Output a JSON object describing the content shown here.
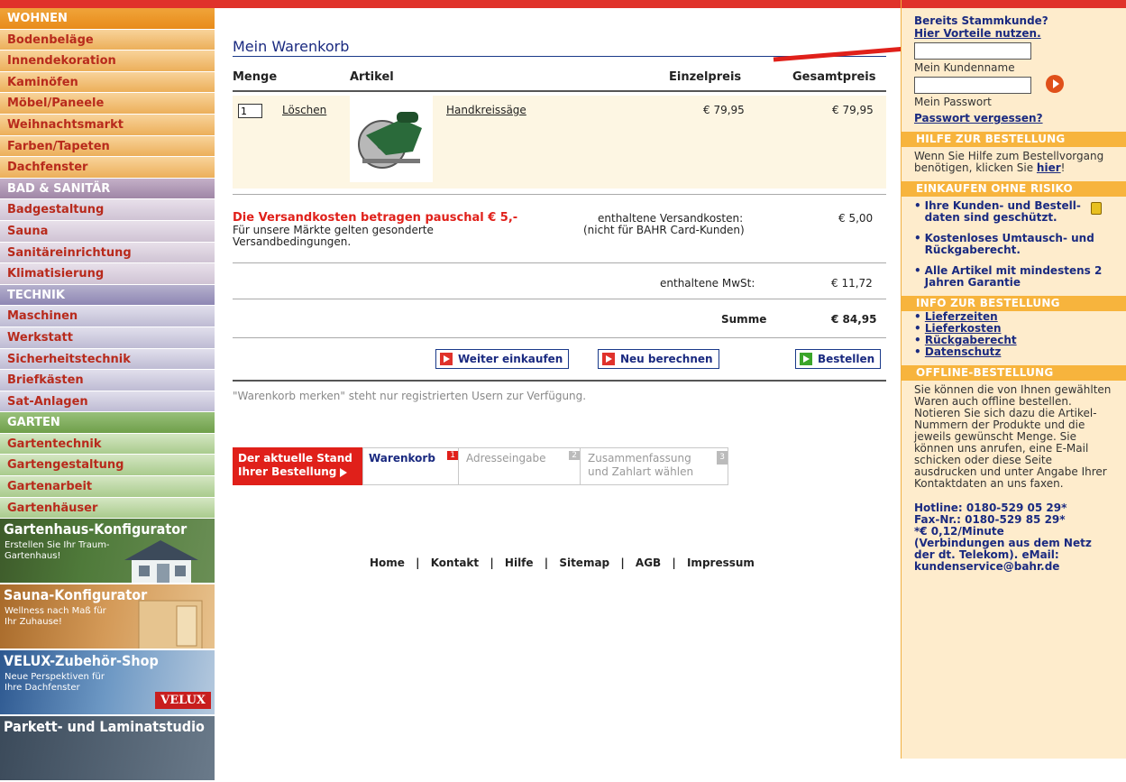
{
  "nav": {
    "items": [
      {
        "label": "WOHNEN"
      },
      {
        "label": "Bodenbeläge"
      },
      {
        "label": "Innendekoration"
      },
      {
        "label": "Kaminöfen"
      },
      {
        "label": "Möbel/Paneele"
      },
      {
        "label": "Weihnachtsmarkt"
      },
      {
        "label": "Farben/Tapeten"
      },
      {
        "label": "Dachfenster"
      },
      {
        "label": "BAD & SANITÄR"
      },
      {
        "label": "Badgestaltung"
      },
      {
        "label": "Sauna"
      },
      {
        "label": "Sanitäreinrichtung"
      },
      {
        "label": "Klimatisierung"
      },
      {
        "label": "TECHNIK"
      },
      {
        "label": "Maschinen"
      },
      {
        "label": "Werkstatt"
      },
      {
        "label": "Sicherheitstechnik"
      },
      {
        "label": "Briefkästen"
      },
      {
        "label": "Sat-Anlagen"
      },
      {
        "label": "GARTEN"
      },
      {
        "label": "Gartentechnik"
      },
      {
        "label": "Gartengestaltung"
      },
      {
        "label": "Gartenarbeit"
      },
      {
        "label": "Gartenhäuser"
      }
    ],
    "banners": [
      {
        "title": "Gartenhaus-Konfigurator",
        "sub": "Erstellen Sie Ihr Traum-Gartenhaus!"
      },
      {
        "title": "Sauna-Konfigurator",
        "sub": "Wellness nach Maß für Ihr Zuhause!"
      },
      {
        "title": "VELUX-Zubehör-Shop",
        "sub": "Neue Perspektiven für Ihre Dachfenster",
        "logo": "VELUX"
      },
      {
        "title": "Parkett- und Laminatstudio",
        "sub": ""
      }
    ]
  },
  "cart": {
    "title": "Mein Warenkorb",
    "headers": {
      "qty": "Menge",
      "article": "Artikel",
      "unit": "Einzelpreis",
      "total": "Gesamtpreis"
    },
    "item": {
      "qty": "1",
      "delete": "Löschen",
      "name": "Handkreissäge",
      "unit_price": "€ 79,95",
      "total_price": "€ 79,95",
      "image_icon": "circular-saw-image"
    },
    "shipping_notice": "Die Versandkosten betragen pauschal € 5,-",
    "shipping_sub": "Für unsere Märkte gelten gesonderte Versandbedingungen.",
    "shipping_label_1": "enthaltene Versandkosten:",
    "shipping_label_2": "(nicht für BAHR Card-Kunden)",
    "shipping_value": "€ 5,00",
    "vat_label": "enthaltene MwSt:",
    "vat_value": "€ 11,72",
    "sum_label": "Summe",
    "sum_value": "€ 84,95",
    "buttons": {
      "continue": "Weiter einkaufen",
      "recalc": "Neu berechnen",
      "order": "Bestellen"
    },
    "remember_note": "\"Warenkorb merken\" steht nur registrierten Usern zur Verfügung."
  },
  "steps": {
    "current_label_1": "Der aktuelle Stand",
    "current_label_2": "Ihrer Bestellung",
    "items": [
      {
        "label": "Warenkorb",
        "num": "1"
      },
      {
        "label": "Adresseingabe",
        "num": "2"
      },
      {
        "label": "Zusammenfassung und Zahlart wählen",
        "num": "3"
      }
    ]
  },
  "footer": {
    "links": [
      "Home",
      "Kontakt",
      "Hilfe",
      "Sitemap",
      "AGB",
      "Impressum"
    ]
  },
  "right": {
    "login": {
      "q": "Bereits Stammkunde?",
      "link": "Hier Vorteile nutzen.",
      "username_label": "Mein Kundenname",
      "password_label": "Mein Passwort",
      "forgot": "Passwort vergessen?"
    },
    "help": {
      "head": "HILFE ZUR BESTELLUNG",
      "text": "Wenn Sie Hilfe zum Bestellvorgang benötigen, klicken Sie",
      "link": "hier"
    },
    "risk": {
      "head": "EINKAUFEN OHNE RISIKO",
      "items": [
        "Ihre Kunden- und Bestell-daten sind geschützt.",
        "Kostenloses Umtausch- und Rückgaberecht.",
        "Alle Artikel mit mindestens 2 Jahren Garantie"
      ]
    },
    "info": {
      "head": "INFO ZUR BESTELLUNG",
      "links": [
        "Lieferzeiten",
        "Lieferkosten",
        "Rückgaberecht",
        "Datenschutz"
      ]
    },
    "offline": {
      "head": "OFFLINE-BESTELLUNG",
      "text": "Sie können die von Ihnen gewählten Waren auch offline bestellen. Notieren Sie sich dazu die Artikel-Nummern der Produkte und die jeweils gewünscht Menge. Sie können uns anrufen, eine E-Mail schicken oder diese Seite ausdrucken und unter Angabe Ihrer Kontaktdaten an uns faxen.",
      "hotline": "Hotline: 0180-529 05 29*",
      "fax": "Fax-Nr.: 0180-529 85 29*",
      "rate": "*€ 0,12/Minute",
      "note": "(Verbindungen aus dem Netz der dt. Telekom). eMail:",
      "email": "kundenservice@bahr.de"
    }
  }
}
